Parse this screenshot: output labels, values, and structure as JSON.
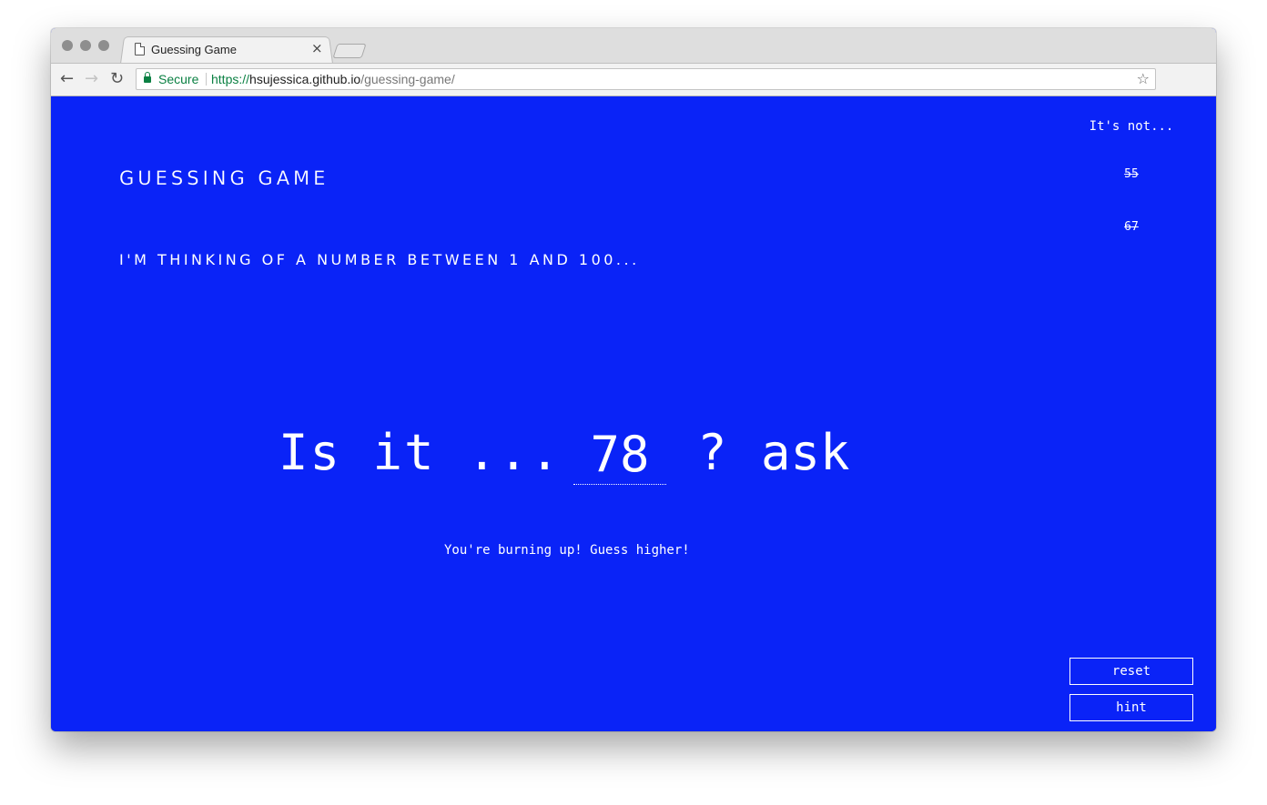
{
  "browser": {
    "tab_title": "Guessing Game",
    "tab_close": "×",
    "secure_label": "Secure",
    "url_scheme": "https://",
    "url_host": "hsujessica.github.io",
    "url_path": "/guessing-game/",
    "back_glyph": "←",
    "forward_glyph": "→",
    "reload_glyph": "↻",
    "star_glyph": "☆"
  },
  "game": {
    "title": "Guessing Game",
    "prompt": "I'm thinking of a number between 1 and 100...",
    "guess_prefix": "Is it ...",
    "guess_value": "78",
    "question_mark": "?",
    "ask_label": "ask",
    "feedback": "You're burning up! Guess higher!"
  },
  "previous_guesses": {
    "heading": "It's not...",
    "items": [
      "55",
      "67"
    ]
  },
  "controls": {
    "reset_label": "reset",
    "hint_label": "hint"
  },
  "colors": {
    "page_background": "#0a23f7",
    "text": "#ffffff",
    "secure_green": "#0b8043"
  }
}
